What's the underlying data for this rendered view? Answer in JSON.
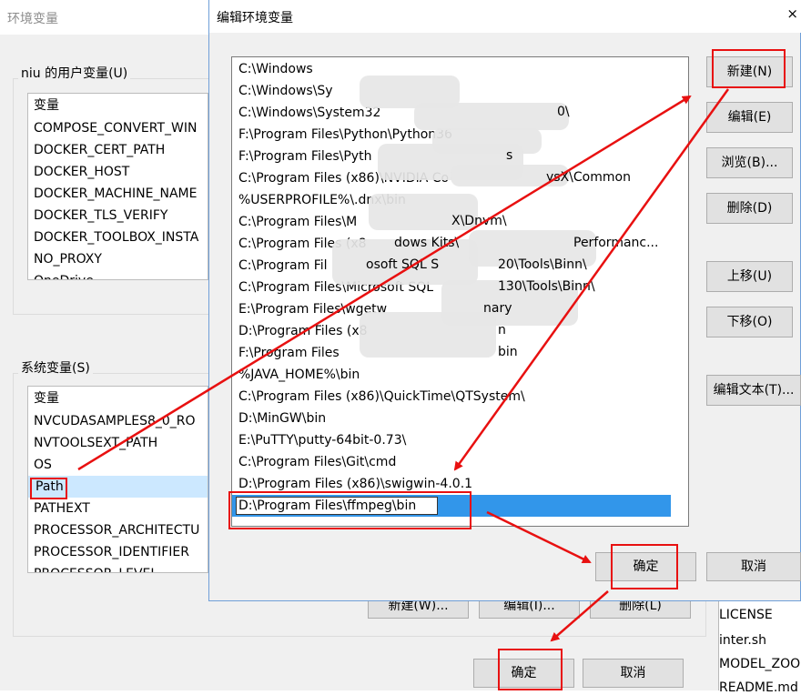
{
  "background_window": {
    "title": "环境变量",
    "user_vars": {
      "group_label": "niu 的用户变量(U)",
      "header": "变量",
      "rows": [
        "COMPOSE_CONVERT_WIN",
        "DOCKER_CERT_PATH",
        "DOCKER_HOST",
        "DOCKER_MACHINE_NAME",
        "DOCKER_TLS_VERIFY",
        "DOCKER_TOOLBOX_INSTA",
        "NO_PROXY",
        "OneDrive"
      ]
    },
    "system_vars": {
      "group_label": "系统变量(S)",
      "header": "变量",
      "rows": [
        "NVCUDASAMPLES8_0_RO",
        "NVTOOLSEXT_PATH",
        "OS",
        "Path",
        "PATHEXT",
        "PROCESSOR_ARCHITECTU",
        "PROCESSOR_IDENTIFIER",
        "PROCESSOR_LEVEL"
      ],
      "selected": "Path"
    },
    "sys_buttons": {
      "new": "新建(W)...",
      "edit": "编辑(I)...",
      "delete": "删除(L)"
    },
    "ok_label": "确定",
    "cancel_label": "取消"
  },
  "right_fragment": {
    "files": [
      "LICENSE",
      "inter.sh",
      "MODEL_ZOO",
      "README.md"
    ]
  },
  "dialog": {
    "title": "编辑环境变量",
    "close_glyph": "×",
    "paths": [
      "C:\\Windows",
      "C:\\Windows\\Sy",
      "C:\\Windows\\System32",
      "F:\\Program Files\\Python\\Python36",
      "F:\\Program Files\\Pyth",
      "C:\\Program Files (x86)\\NVIDIA Co",
      "%USERPROFILE%\\.dnx\\bin",
      "C:\\Program Files\\M",
      "C:\\Program Files (x8",
      "C:\\Program Fil",
      "C:\\Program Files\\Microsoft SQL",
      "E:\\Program Files\\wgetw",
      "D:\\Program Files (x8",
      "F:\\Program Files",
      "%JAVA_HOME%\\bin",
      "C:\\Program Files (x86)\\QuickTime\\QTSystem\\",
      "D:\\MinGW\\bin",
      "E:\\PuTTY\\putty-64bit-0.73\\",
      "C:\\Program Files\\Git\\cmd",
      "D:\\Program Files (x86)\\swigwin-4.0.1"
    ],
    "path_fragments": {
      "f2": "0\\",
      "f5": "s",
      "f6": "ysX\\Common",
      "f7": "X\\Dnvm\\",
      "f8a": "dows Kits\\",
      "f8b": "Performanc...",
      "f9a": "osoft SQL S",
      "f9b": "20\\Tools\\Binn\\",
      "f10": "130\\Tools\\Binn\\",
      "f11": "nary",
      "f12": "n",
      "f13": "bin"
    },
    "editing_value": "D:\\Program Files\\ffmpeg\\bin",
    "buttons": {
      "new": "新建(N)",
      "edit": "编辑(E)",
      "browse": "浏览(B)...",
      "delete": "删除(D)",
      "move_up": "上移(U)",
      "move_down": "下移(O)",
      "edit_text": "编辑文本(T)..."
    },
    "ok_label": "确定",
    "cancel_label": "取消",
    "scroll_up_glyph": "▲",
    "scroll_down_glyph": "▼"
  },
  "colors": {
    "annotation_red": "#e81010",
    "selection_blue": "#3296ea",
    "selection_light": "#cce8ff"
  }
}
